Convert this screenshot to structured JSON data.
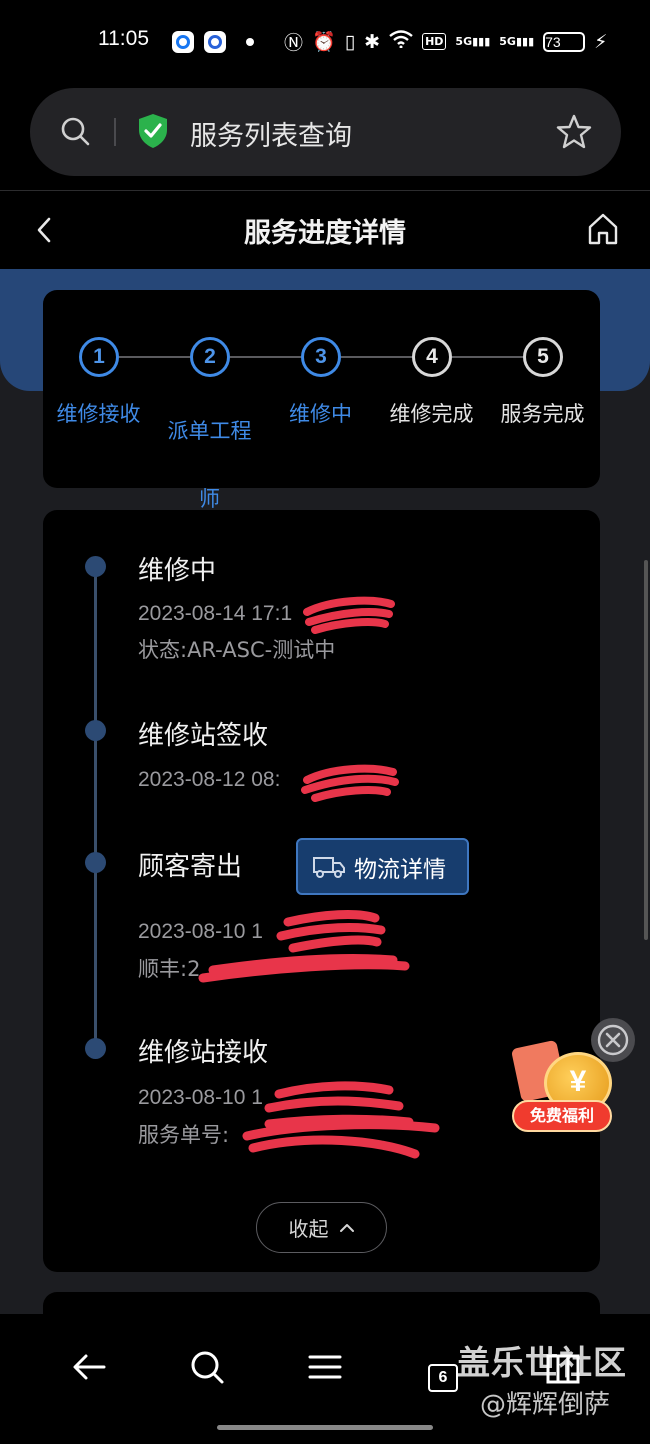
{
  "status_bar": {
    "time": "11:05",
    "icons": [
      "app-q-icon",
      "app-circle-icon",
      "dot-icon",
      "nfc-icon",
      "alarm-icon",
      "vibrate-icon",
      "bluetooth-icon",
      "wifi-icon",
      "hd-icon",
      "5g-signal-icon",
      "5g-signal-icon",
      "battery-icon",
      "charging-icon"
    ],
    "hd_label": "HD",
    "signal1_label": "5G",
    "signal2_label": "5G",
    "battery": "73"
  },
  "browser": {
    "search_text": "服务列表查询"
  },
  "header": {
    "title": "服务进度详情"
  },
  "steps": [
    {
      "number": "1",
      "label": "维修接收",
      "active": true
    },
    {
      "number": "2",
      "label": "派单工程师",
      "active": true
    },
    {
      "number": "3",
      "label": "维修中",
      "active": true
    },
    {
      "number": "4",
      "label": "维修完成",
      "active": false
    },
    {
      "number": "5",
      "label": "服务完成",
      "active": false
    }
  ],
  "timeline": [
    {
      "title": "维修中",
      "lines": [
        "2023-08-14 17:1",
        "状态:AR-ASC-测试中"
      ]
    },
    {
      "title": "维修站签收",
      "lines": [
        "2023-08-12 08:"
      ]
    },
    {
      "title": "顾客寄出",
      "lines": [
        "2023-08-10 1",
        "顺丰:2"
      ],
      "button": "物流详情"
    },
    {
      "title": "维修站接收",
      "lines": [
        "2023-08-10 1",
        "服务单号:"
      ]
    }
  ],
  "collapse_label": "收起",
  "promo": {
    "coin_symbol": "¥",
    "label": "免费福利"
  },
  "bottom_nav": {
    "tab_count": "6",
    "watermark_line1": "盖乐世社区",
    "watermark_line2": "@辉辉倒萨"
  },
  "colors": {
    "accent": "#3f8ae6",
    "blue_band": "#264778",
    "background": "#1c1d21",
    "card": "#000000",
    "redaction": "#e8354a"
  }
}
